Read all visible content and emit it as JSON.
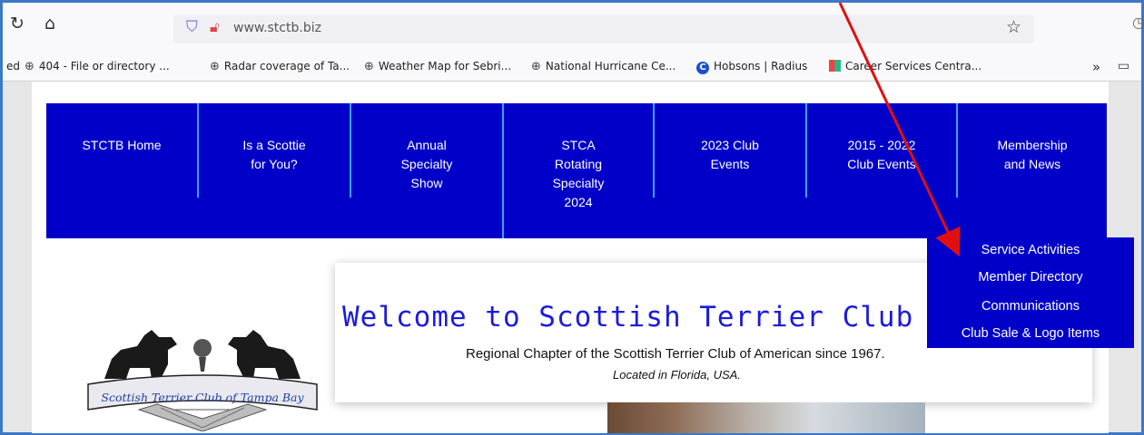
{
  "browser": {
    "url": "www.stctb.biz",
    "icons": {
      "reload": "reload-icon",
      "home": "home-icon",
      "shield": "shield-icon",
      "insecure": "insecure-lock-icon",
      "bookmark_star": "star-icon",
      "overflow": "chevron-double-right-icon",
      "folder": "folder-icon"
    },
    "bookmarks_prefix": "ed",
    "bookmarks": [
      {
        "label": "404 - File or directory ...",
        "icon": "globe-icon"
      },
      {
        "label": "Radar coverage of Ta...",
        "icon": "globe-icon"
      },
      {
        "label": "Weather Map for Sebri...",
        "icon": "globe-icon"
      },
      {
        "label": "National Hurricane Ce...",
        "icon": "globe-icon"
      },
      {
        "label": "Hobsons | Radius",
        "icon": "hobsons-icon"
      },
      {
        "label": "Career Services Centra...",
        "icon": "tile-icon"
      }
    ]
  },
  "nav": {
    "items": [
      {
        "line1": "STCTB Home"
      },
      {
        "line1": "Is a Scottie",
        "line2": "for You?"
      },
      {
        "line1": "Annual",
        "line2": "Specialty",
        "line3": "Show"
      },
      {
        "line1": "STCA",
        "line2": "Rotating",
        "line3": "Specialty",
        "line4": "2024"
      },
      {
        "line1": "2023 Club",
        "line2": "Events"
      },
      {
        "line1": "2015 - 2022",
        "line2": "Club Events"
      },
      {
        "line1": "Membership",
        "line2": "and News"
      }
    ],
    "dropdown": [
      "Service Activities",
      "Member Directory",
      "Communications",
      "Club Sale & Logo Items"
    ]
  },
  "main": {
    "welcome": "Welcome to Scottish Terrier Club of T",
    "subtitle": "Regional Chapter of the Scottish Terrier Club of American since 1967.",
    "location": "Located in Florida, USA.",
    "logo_text": "Scottish Terrier Club of Tampa Bay"
  },
  "colors": {
    "nav_bg": "#0000c8",
    "separator": "#3aa0ff",
    "welcome_text": "#1b1bdc",
    "annotation_arrow": "#e01010"
  }
}
